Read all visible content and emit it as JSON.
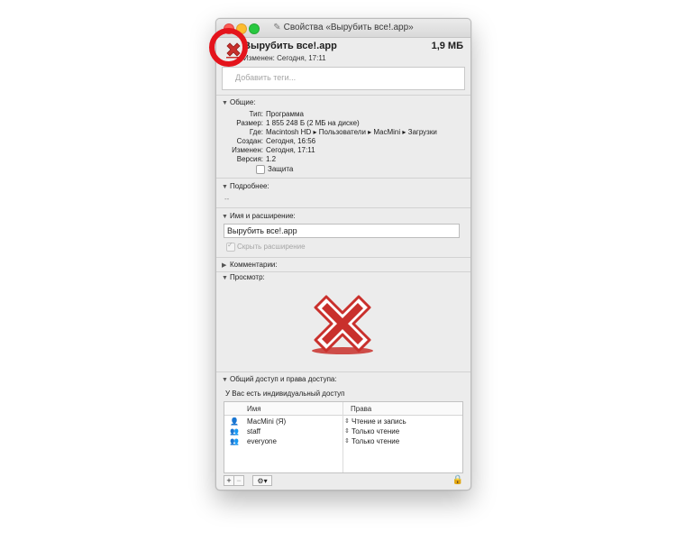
{
  "window": {
    "title": "Свойства «Вырубить все!.app»"
  },
  "header": {
    "name": "Вырубить все!.app",
    "size": "1,9 МБ",
    "modified": "Изменен: Сегодня, 17:11"
  },
  "tags": {
    "placeholder": "Добавить теги..."
  },
  "general": {
    "title": "Общие:",
    "rows": [
      {
        "label": "Тип:",
        "value": "Программа"
      },
      {
        "label": "Размер:",
        "value": "1 855 248 Б (2 МБ на диске)"
      },
      {
        "label": "Где:",
        "value": "Macintosh HD ▸ Пользователи ▸ MacMini ▸ Загрузки"
      },
      {
        "label": "Создан:",
        "value": "Сегодня, 16:56"
      },
      {
        "label": "Изменен:",
        "value": "Сегодня, 17:11"
      },
      {
        "label": "Версия:",
        "value": "1.2"
      }
    ],
    "locked_label": "Защита"
  },
  "more_info": {
    "title": "Подробнее:",
    "value": "--"
  },
  "name_ext": {
    "title": "Имя и расширение:",
    "value": "Вырубить все!.app",
    "hide_ext_label": "Скрыть расширение"
  },
  "comments": {
    "title": "Комментарии:"
  },
  "preview": {
    "title": "Просмотр:"
  },
  "sharing": {
    "title": "Общий доступ и права доступа:",
    "access_text": "У Вас есть индивидуальный доступ",
    "col_name": "Имя",
    "col_priv": "Права",
    "rows": [
      {
        "name": "MacMini (Я)",
        "privilege": "Чтение и запись",
        "icon": "user-icon"
      },
      {
        "name": "staff",
        "privilege": "Только чтение",
        "icon": "group-icon"
      },
      {
        "name": "everyone",
        "privilege": "Только чтение",
        "icon": "group-icon"
      }
    ]
  },
  "toolbar": {
    "add": "+",
    "remove": "−",
    "gear": "⚙▾"
  },
  "colors": {
    "accent": "#e4141c",
    "icon_red": "#c9302c"
  }
}
